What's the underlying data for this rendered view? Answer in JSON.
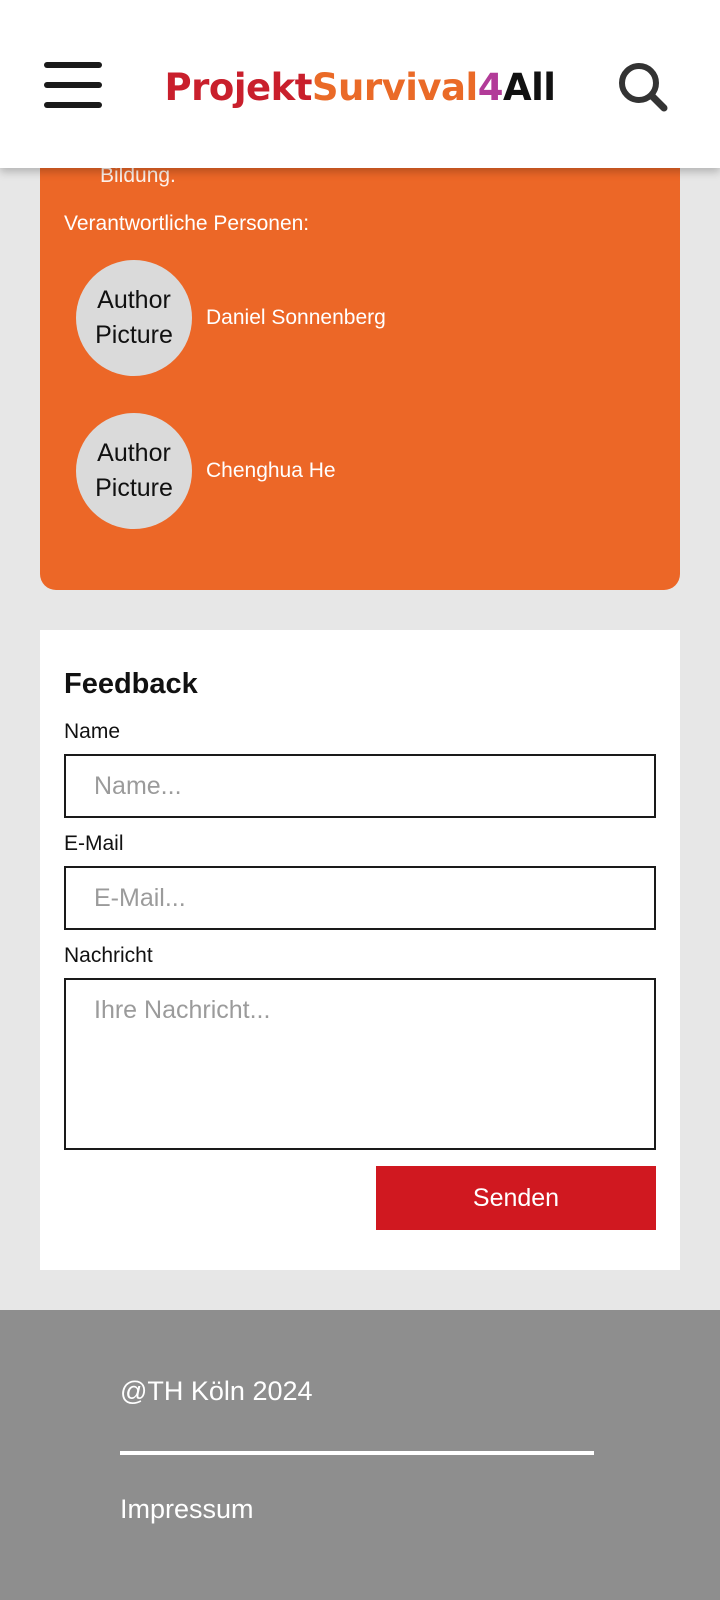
{
  "header": {
    "logo": {
      "part1": "Projekt",
      "part2": "Survival",
      "part3": "4",
      "part4": "All"
    },
    "menu_icon": "hamburger-menu-icon",
    "search_icon": "search-icon"
  },
  "project": {
    "cut_text": "Bildung.",
    "responsible_label": "Verantwortliche Personen:",
    "authors": [
      {
        "picture": "Author Picture",
        "name": "Daniel Sonnenberg"
      },
      {
        "picture": "Author Picture",
        "name": "Chenghua He"
      }
    ]
  },
  "feedback": {
    "title": "Feedback",
    "name_label": "Name",
    "name_placeholder": "Name...",
    "email_label": "E-Mail",
    "email_placeholder": "E-Mail...",
    "message_label": "Nachricht",
    "message_placeholder": "Ihre Nachricht...",
    "submit_label": "Senden"
  },
  "footer": {
    "copyright": "@TH Köln 2024",
    "impressum": "Impressum"
  },
  "colors": {
    "orange": "#ec6727",
    "red": "#d01820",
    "logo_red": "#c91f2c",
    "logo_purple": "#b23b98",
    "footer_gray": "#8e8e8e",
    "page_background": "#e7e7e7"
  }
}
